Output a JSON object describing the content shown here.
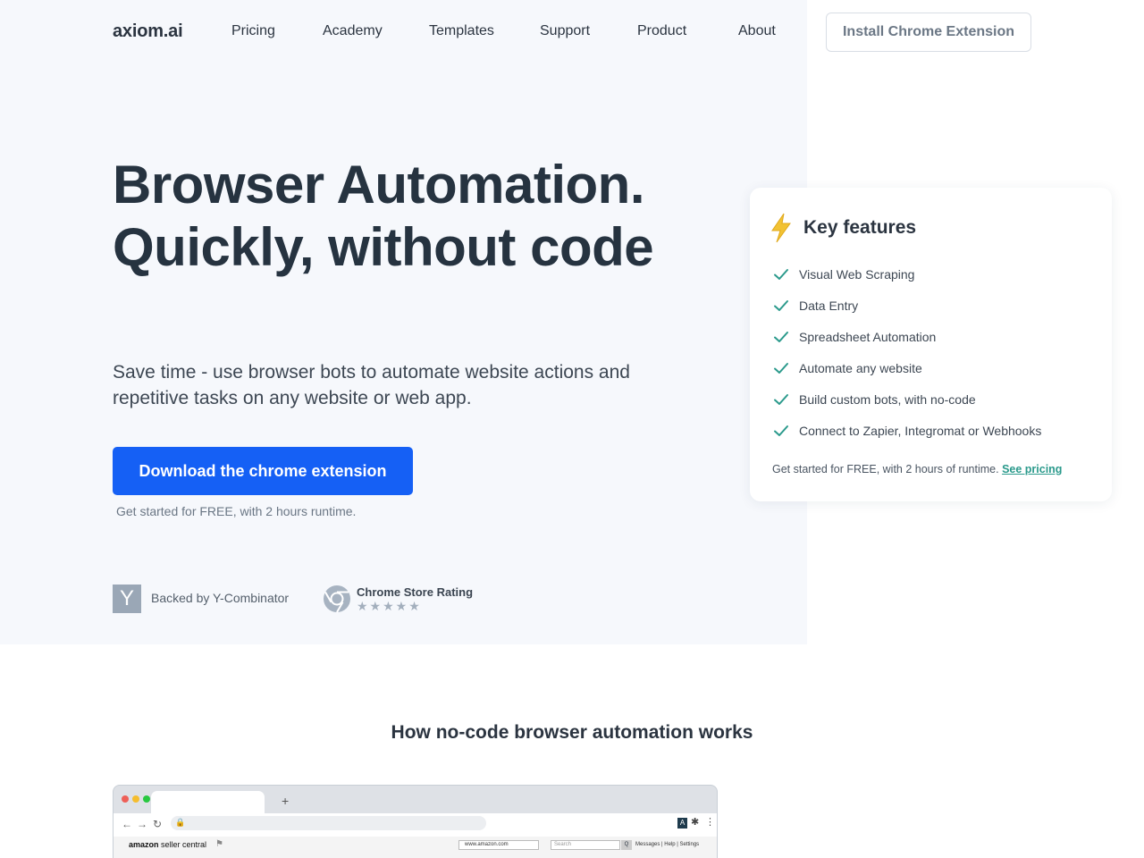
{
  "nav": {
    "logo": "axiom.ai",
    "links": [
      "Pricing",
      "Academy",
      "Templates",
      "Support",
      "Product",
      "About"
    ],
    "install_label": "Install Chrome Extension"
  },
  "hero": {
    "title": "Browser Automation. Quickly, without code",
    "subtitle": "Save time - use browser bots to automate website actions and repetitive tasks on any website or web app.",
    "cta_label": "Download the chrome extension",
    "cta_note": "Get started for FREE, with 2 hours runtime.",
    "yc_letter": "Y",
    "yc_text": "Backed by Y-Combinator",
    "rating_title": "Chrome Store Rating",
    "rating_stars": "★★★★★"
  },
  "features": {
    "title": "Key features",
    "items": [
      "Visual Web Scraping",
      "Data Entry",
      "Spreadsheet Automation",
      "Automate any website",
      "Build custom bots, with no-code",
      "Connect to Zapier, Integromat or Webhooks"
    ],
    "footer_text": "Get started for FREE, with 2 hours of runtime.",
    "footer_link": "See pricing"
  },
  "section": {
    "title": "How no-code browser automation works"
  },
  "browser_mock": {
    "new_tab": "+",
    "back": "←",
    "forward": "→",
    "reload": "↻",
    "lock": "🔒",
    "ext_letter": "A",
    "puzzle": "✱",
    "more": "⋮",
    "site_logo_bold": "amazon",
    "site_logo_rest": " seller central",
    "flag": "⚑",
    "select_value": "www.amazon.com",
    "search_placeholder": "Search",
    "search_btn": "Q",
    "links": "Messages | Help | Settings"
  },
  "colors": {
    "primary": "#1560f5",
    "accent": "#2b9a8c",
    "hero_bg": "#f6f8fc",
    "text": "#2b3440",
    "bolt": "#f2c233"
  }
}
